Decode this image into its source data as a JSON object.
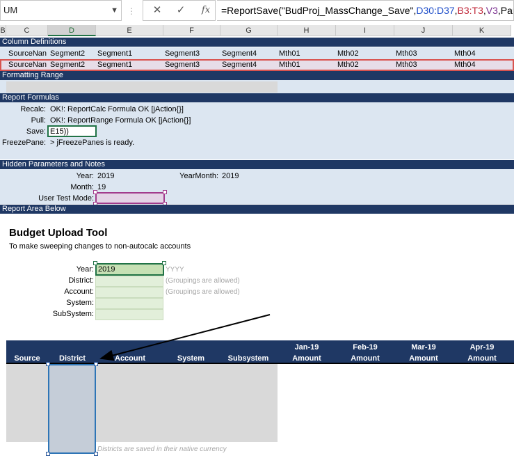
{
  "formula_bar": {
    "name_box": "UM",
    "cancel_icon": "✕",
    "enter_icon": "✓",
    "fx_icon": "fx",
    "formula_parts": [
      {
        "text": "=ReportSave(\"BudProj_MassChange_Save\",",
        "color": "plain"
      },
      {
        "text": "D30:D37",
        "color": "blue"
      },
      {
        "text": ",",
        "color": "plain"
      },
      {
        "text": "B3:T3",
        "color": "red"
      },
      {
        "text": ",",
        "color": "plain"
      },
      {
        "text": "V3",
        "color": "purple"
      },
      {
        "text": ",Param",
        "color": "plain"
      }
    ]
  },
  "columns": [
    "B",
    "C",
    "D",
    "E",
    "F",
    "G",
    "H",
    "I",
    "J",
    "K"
  ],
  "selected_column": "D",
  "sections": {
    "column_definitions": "Column Definitions",
    "formatting_range": "Formatting Range",
    "report_formulas": "Report Formulas",
    "hidden_parameters": "Hidden Parameters and Notes",
    "report_area": "Report Area Below"
  },
  "column_def_row": [
    "SourceNan",
    "Segment2",
    "Segment1",
    "Segment3",
    "Segment4",
    "Mth01",
    "Mth02",
    "Mth03",
    "Mth04"
  ],
  "formulas": {
    "recalc_label": "Recalc:",
    "recalc_value": "OK!: ReportCalc Formula OK [jAction{}]",
    "pull_label": "Pull:",
    "pull_value": "OK!: ReportRange Formula OK [jAction{}]",
    "save_label": "Save:",
    "save_value": "E15))",
    "freeze_label": "FreezePane:",
    "freeze_value": "> jFreezePanes is ready."
  },
  "params": {
    "year_label": "Year:",
    "year_value": "2019",
    "yearmonth_label": "YearMonth:",
    "yearmonth_value": "2019",
    "month_label": "Month:",
    "month_value": "19",
    "user_test_label": "User Test Mode:"
  },
  "report": {
    "title": "Budget Upload Tool",
    "subtitle": "To make sweeping changes to non-autocalc accounts",
    "year_label": "Year:",
    "year_value": "2019",
    "year_hint": "YYYY",
    "district_label": "District:",
    "district_hint": "(Groupings are allowed)",
    "account_label": "Account:",
    "account_hint": "(Groupings are allowed)",
    "system_label": "System:",
    "subsystem_label": "SubSystem:",
    "footnote": "Districts are saved in their native currency"
  },
  "table": {
    "headers": [
      "Source",
      "District",
      "Account",
      "System",
      "Subsystem"
    ],
    "months": [
      "Jan-19",
      "Feb-19",
      "Mar-19",
      "Apr-19"
    ],
    "amount_label": "Amount"
  },
  "colors": {
    "section_bar": "#1f3864",
    "band": "#dce6f1",
    "input_green": "#e2efda",
    "highlight_red": "#d9534f"
  }
}
